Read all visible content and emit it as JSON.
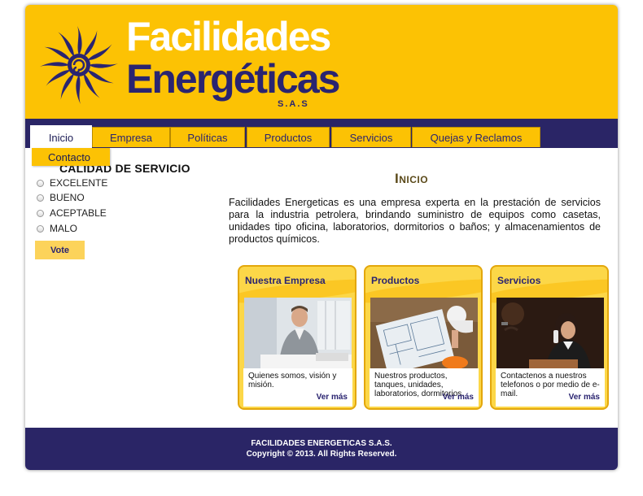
{
  "brand": {
    "line1": "Facilidades",
    "line2": "Energéticas",
    "suffix": "S.A.S",
    "colors": {
      "yellow": "#fcc204",
      "navy": "#2a2566",
      "text_navy": "#2a2470"
    }
  },
  "nav": {
    "tabs": [
      {
        "label": "Inicio"
      },
      {
        "label": "Empresa"
      },
      {
        "label": "Políticas"
      },
      {
        "label": "Productos"
      },
      {
        "label": "Servicios"
      },
      {
        "label": "Quejas y Reclamos"
      }
    ],
    "dropdown_item": "Contacto"
  },
  "poll": {
    "title": "CALIDAD DE SERVICIO",
    "options": [
      "EXCELENTE",
      "BUENO",
      "ACEPTABLE",
      "MALO"
    ],
    "vote_label": "Vote"
  },
  "main": {
    "heading": "Inicio",
    "intro": "Facilidades Energeticas es una empresa experta en la prestación de servicios para la industria petrolera, brindando suministro de equipos como casetas, unidades tipo oficina, laboratorios, dormitorios o baños; y almacenamientos de productos químicos."
  },
  "cards": [
    {
      "title": "Nuestra Empresa",
      "text": "Quienes somos, visión y misión.",
      "more": "Ver más"
    },
    {
      "title": "Productos",
      "text": "Nuestros productos, tanques, unidades, laboratorios, dormitorios.",
      "more": "Ver más"
    },
    {
      "title": "Servicios",
      "text": "Contactenos a nuestros telefonos o por medio de e-mail.",
      "more": "Ver más"
    }
  ],
  "footer": {
    "line1": "FACILIDADES ENERGETICAS S.A.S.",
    "line2": "Copyright © 2013. All Rights Reserved."
  }
}
